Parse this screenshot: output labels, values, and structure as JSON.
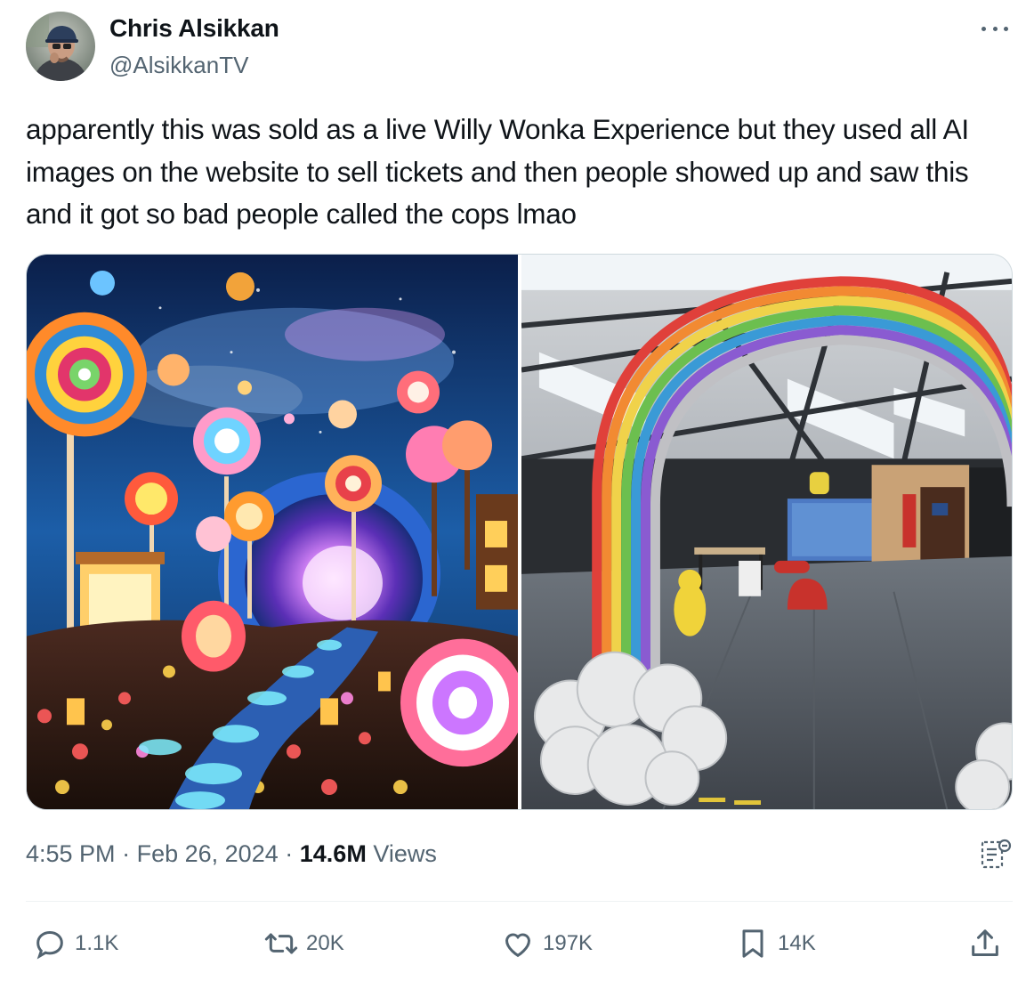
{
  "author": {
    "display_name": "Chris Alsikkan",
    "handle": "@AlsikkanTV"
  },
  "tweet": {
    "text": "apparently this was sold as a live Willy Wonka Experience but they used all AI images on the website to sell tickets and then people showed up and saw this and it got so bad people called the cops lmao"
  },
  "meta": {
    "time": "4:55 PM",
    "separator": "·",
    "date": "Feb 26, 2024",
    "views_count": "14.6M",
    "views_label": "Views"
  },
  "actions": {
    "reply_count": "1.1K",
    "retweet_count": "20K",
    "like_count": "197K",
    "bookmark_count": "14K"
  },
  "icons": {
    "more": "more-horizontal-icon",
    "analytics": "analytics-icon",
    "reply": "reply-icon",
    "retweet": "retweet-icon",
    "like": "heart-icon",
    "bookmark": "bookmark-icon",
    "share": "share-icon"
  },
  "colors": {
    "text_primary": "#0f1419",
    "text_secondary": "#536471",
    "border": "#cfd9de"
  }
}
